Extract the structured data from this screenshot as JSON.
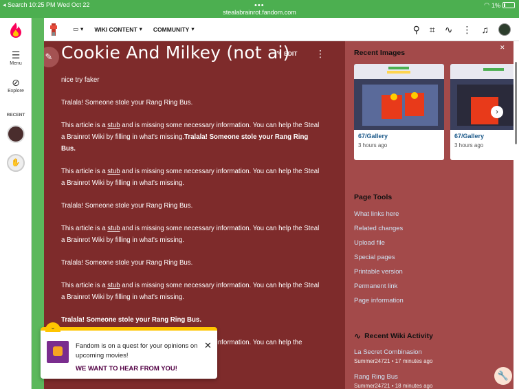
{
  "status_bar": {
    "left": "◂ Search  10:25 PM  Wed Oct 22",
    "url": "stealabrainrot.fandom.com",
    "battery": "1%"
  },
  "global_nav": {
    "menu_label": "Menu",
    "explore_label": "Explore",
    "recent_label": "RECENT"
  },
  "topbar": {
    "wiki_content_label": "WIKI CONTENT",
    "community_label": "COMMUNITY"
  },
  "article": {
    "title": "Cookie And Milkey (not ai)",
    "edit_label": "EDIT",
    "paragraphs": [
      {
        "text": "nice try faker"
      },
      {
        "text": "Tralala! Someone stole your Rang Ring Bus."
      },
      {
        "pre": "This article is a ",
        "link": "stub",
        "post": " and is missing some necessary information. You can help the Steal a Brainrot Wiki by filling in what's missing.",
        "bold": "Tralala! Someone stole your Rang Ring Bus."
      },
      {
        "pre": "This article is a ",
        "link": "stub",
        "post": " and is missing some necessary information. You can help the Steal a Brainrot Wiki by filling in what's missing."
      },
      {
        "text": "Tralala! Someone stole your Rang Ring Bus."
      },
      {
        "pre": "This article is a ",
        "link": "stub",
        "post": " and is missing some necessary information. You can help the Steal a Brainrot Wiki by filling in what's missing."
      },
      {
        "text": "Tralala! Someone stole your Rang Ring Bus."
      },
      {
        "pre": "This article is a ",
        "link": "stub",
        "post": " and is missing some necessary information. You can help the Steal a Brainrot Wiki by filling in what's missing."
      },
      {
        "bold_only": "Tralala! Someone stole your Rang Ring Bus."
      },
      {
        "pre": "This article is a ",
        "link": "stub",
        "post": " and is missing some necessary information. You can help the"
      }
    ]
  },
  "rail": {
    "recent_images_title": "Recent Images",
    "images": [
      {
        "title": "67/Gallery",
        "time": "3 hours ago"
      },
      {
        "title": "67/Gallery",
        "time": "3 hours ago"
      }
    ],
    "page_tools_title": "Page Tools",
    "page_tools": [
      "What links here",
      "Related changes",
      "Upload file",
      "Special pages",
      "Printable version",
      "Permanent link",
      "Page information"
    ],
    "activity_title": "Recent Wiki Activity",
    "activity": [
      {
        "title": "La Secret Combinasion",
        "meta": "Summer24721 • 17 minutes ago"
      },
      {
        "title": "Rang Ring Bus",
        "meta": "Summer24721 • 18 minutes ago"
      }
    ]
  },
  "toast": {
    "message": "Fandom is on a quest for your opinions on upcoming movies!",
    "cta": "WE WANT TO HEAR FROM YOU!"
  },
  "colors": {
    "article_bg": "#7e2b2b",
    "rail_bg": "#a34a4a",
    "accent_green": "#5cb85c",
    "toast_accent": "#ffc500"
  }
}
